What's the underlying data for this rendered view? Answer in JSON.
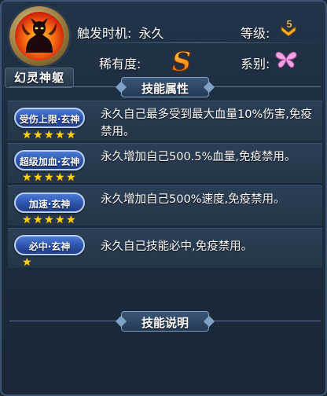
{
  "hero": {
    "name": "幻灵神躯"
  },
  "header": {
    "trigger_label": "触发时机:",
    "trigger_value": "永久",
    "level_label": "等级:",
    "level_value": "5",
    "rarity_label": "稀有度:",
    "rarity_value": "S",
    "series_label": "系别:"
  },
  "sections": {
    "skills_title": "技能属性",
    "desc_title": "技能说明"
  },
  "skills": [
    {
      "name": "受伤上限·玄神",
      "stars": 5,
      "desc": "永久自己最多受到最大血量10%伤害,免疫禁用。"
    },
    {
      "name": "超级加血·玄神",
      "stars": 5,
      "desc": "永久增加自己500.5%血量,免疫禁用。"
    },
    {
      "name": "加速·玄神",
      "stars": 5,
      "desc": "永久增加自己500%速度,免疫禁用。"
    },
    {
      "name": "必中·玄神",
      "stars": 1,
      "desc": "永久自己技能必中,免疫禁用。"
    }
  ],
  "colors": {
    "panel_bg": "#1c2b3e",
    "badge_blue": "#2a4fa6",
    "star_gold": "#ffd21e",
    "rarity_orange": "#ff9a1e",
    "series_pink": "#f08ad8"
  },
  "icons": {
    "level": "chevron-up-icon",
    "rarity": "s-rank-icon",
    "series": "butterfly-icon"
  }
}
